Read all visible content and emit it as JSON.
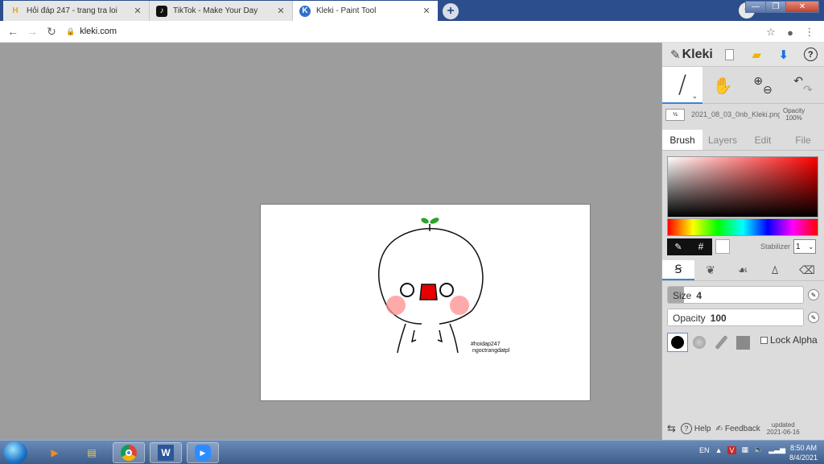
{
  "browser": {
    "tabs": [
      {
        "title": "Hỏi đáp 247 - trang tra loi",
        "favicon": "H",
        "active": false
      },
      {
        "title": "TikTok - Make Your Day",
        "favicon": "♪",
        "active": false
      },
      {
        "title": "Kleki - Paint Tool",
        "favicon": "K",
        "active": true
      }
    ],
    "close_glyph": "✕",
    "url": "kleki.com"
  },
  "canvas": {
    "watermark_line1": "#hoidap247",
    "watermark_line2": "ngoctrangdatpl"
  },
  "panel": {
    "logo": "Kleki",
    "file_thumb": "½",
    "file_name": "2021_08_03_0nb_Kleki.png",
    "opacity_label": "Opacity",
    "opacity_value": "100%",
    "tabs": [
      "Brush",
      "Layers",
      "Edit",
      "File"
    ],
    "stabilizer_label": "Stabilizer",
    "stabilizer_value": "1",
    "size_label": "Size",
    "size_value": 4,
    "size_fraction": 0.12,
    "brush_opacity_label": "Opacity",
    "brush_opacity_value": 100,
    "brush_opacity_fraction": 1.0,
    "lock_alpha_label": "Lock Alpha",
    "footer_help": "Help",
    "footer_feedback": "Feedback",
    "updated_label": "updated",
    "updated_date": "2021-06-16"
  },
  "taskbar": {
    "language": "EN",
    "time": "8:50 AM",
    "date": "8/4/2021"
  },
  "colors": {
    "tab_strip": "#2c4e8d",
    "nose": "#e60000",
    "sprout": "#2aa52a",
    "blush": "#ff8d8d"
  }
}
